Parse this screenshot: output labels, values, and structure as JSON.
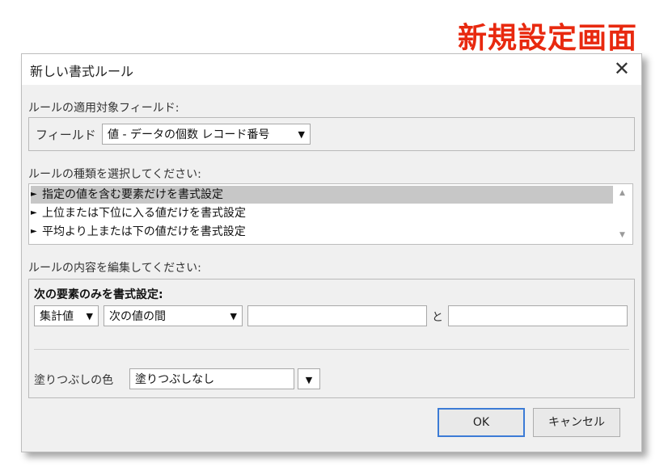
{
  "caption": "新規設定画面",
  "dialog": {
    "title": "新しい書式ルール",
    "close_glyph": "✕",
    "field_section_label": "ルールの適用対象フィールド:",
    "field_label": "フィールド",
    "field_value": "値 - データの個数 レコード番号",
    "rule_type_label": "ルールの種類を選択してください:",
    "rule_types": [
      {
        "label": "指定の値を含む要素だけを書式設定",
        "selected": true
      },
      {
        "label": "上位または下位に入る値だけを書式設定",
        "selected": false
      },
      {
        "label": "平均より上または下の値だけを書式設定",
        "selected": false
      }
    ],
    "edit_label": "ルールの内容を編集してください:",
    "format_only_label": "次の要素のみを書式設定:",
    "aggregate_value": "集計値",
    "condition_value": "次の値の間",
    "value1": "",
    "value2": "",
    "and_label": "と",
    "fill_label": "塗りつぶしの色",
    "fill_value": "塗りつぶしなし",
    "ok_label": "OK",
    "cancel_label": "キャンセル"
  }
}
